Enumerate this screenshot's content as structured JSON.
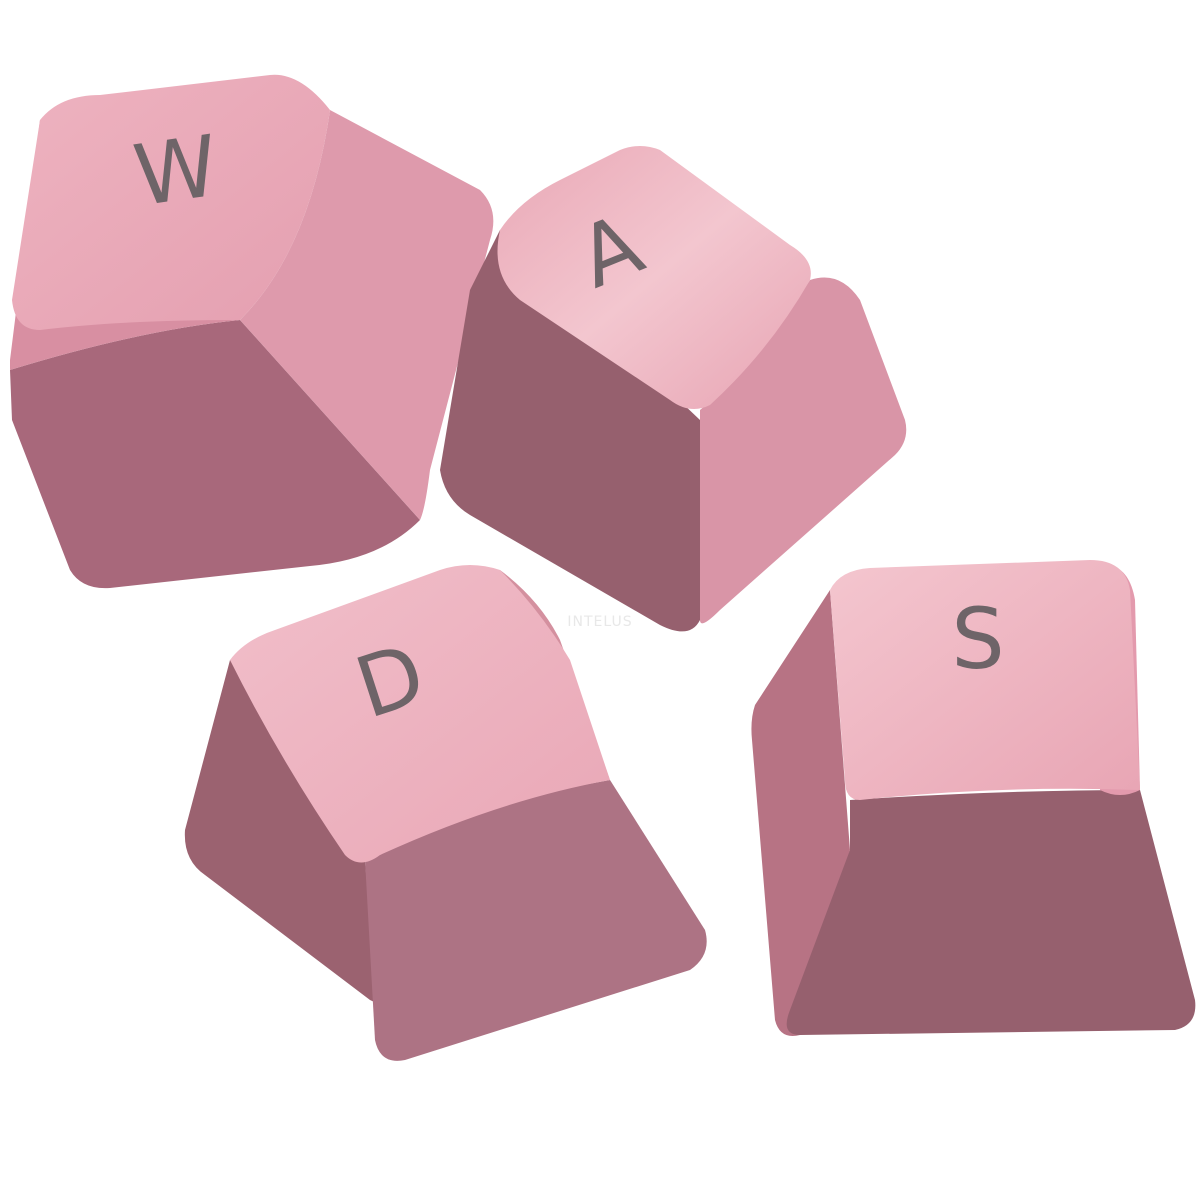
{
  "keycaps": [
    {
      "legend": "W"
    },
    {
      "legend": "A"
    },
    {
      "legend": "D"
    },
    {
      "legend": "S"
    }
  ],
  "watermark": "INTELUS",
  "colors": {
    "top_light": "#f2c2cc",
    "top_mid": "#e7a6b5",
    "side_light": "#e39aad",
    "side_mid": "#c9808f",
    "side_dark": "#96606e",
    "legend": "#6e6468",
    "background": "#ffffff"
  }
}
